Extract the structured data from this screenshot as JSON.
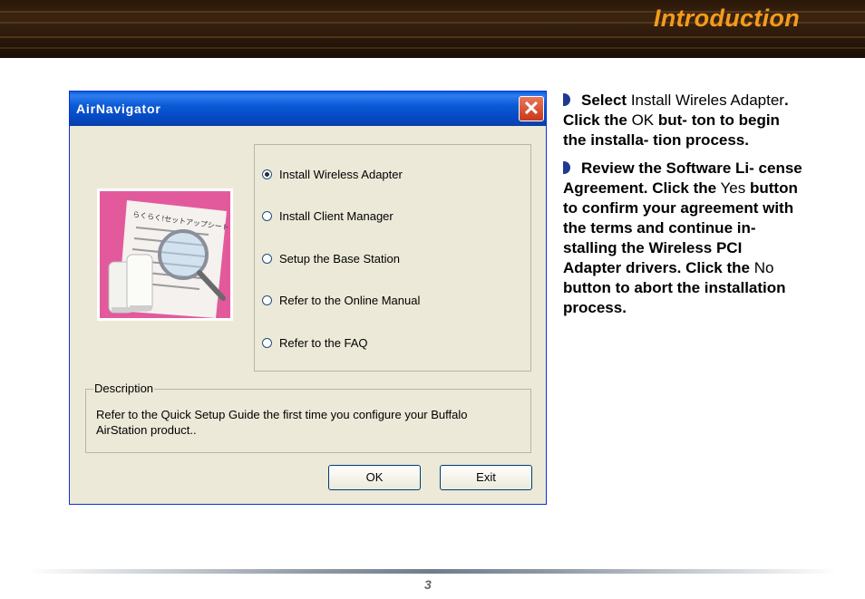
{
  "header": {
    "title": "Introduction"
  },
  "dialog": {
    "title": "AirNavigator",
    "close_symbol": "✕",
    "options": [
      {
        "label": "Install Wireless Adapter",
        "selected": true
      },
      {
        "label": "Install Client Manager",
        "selected": false
      },
      {
        "label": "Setup the Base Station",
        "selected": false
      },
      {
        "label": "Refer to the Online Manual",
        "selected": false
      },
      {
        "label": "Refer to the FAQ",
        "selected": false
      }
    ],
    "description_label": "Description",
    "description_text": "Refer to the Quick Setup Guide the first time you configure your Buffalo AirStation product..",
    "ok_label": "OK",
    "exit_label": "Exit"
  },
  "instructions": [
    {
      "b1": "Select",
      "u1": " Install Wireles Adapter",
      "b2": ".  Click the",
      "u2": " OK",
      "b3": " but- ton to begin the installa- tion process."
    },
    {
      "b1": "Review the Software Li- cense Agreement.  Click the",
      "u1": " Yes",
      "b2": " button to confirm your agreement with the terms and continue in- stalling the Wireless PCI Adapter drivers.  Click the",
      "u2": " No",
      "b3": " button to abort the installation process."
    }
  ],
  "footer": {
    "page_number": "3"
  },
  "colors": {
    "accent": "#f59b1c",
    "titlebar": "#0b5ad6",
    "bullet": "#1f3b8f"
  }
}
